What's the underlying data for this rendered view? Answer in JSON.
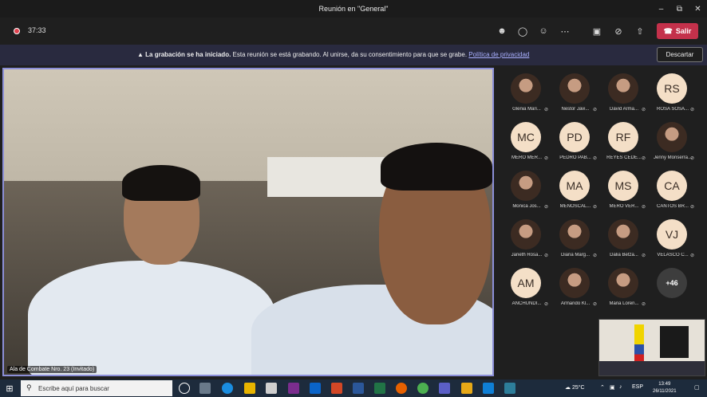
{
  "window": {
    "title": "Reunión en \"General\""
  },
  "toolbar": {
    "timer": "37:33",
    "leave_label": "Salir"
  },
  "banner": {
    "title": "La grabación se ha iniciado.",
    "message": "Esta reunión se está grabando. Al unirse, da su consentimiento para que se grabe.",
    "link": "Política de privacidad",
    "dismiss": "Descartar"
  },
  "stage": {
    "label": "Ala de Combate Nro. 23 (Invitado)"
  },
  "participants": [
    {
      "initials": "",
      "name": "Glenia Mari...",
      "photo": true
    },
    {
      "initials": "",
      "name": "Nestor Javi...",
      "photo": true
    },
    {
      "initials": "",
      "name": "David Arma...",
      "photo": true
    },
    {
      "initials": "RS",
      "name": "ROSA SOSA...",
      "photo": false
    },
    {
      "initials": "MC",
      "name": "MERO MER...",
      "photo": false
    },
    {
      "initials": "PD",
      "name": "PEDRO PAB...",
      "photo": false
    },
    {
      "initials": "RF",
      "name": "REYES CEDE...",
      "photo": false
    },
    {
      "initials": "",
      "name": "Jenny Monserra...",
      "photo": true
    },
    {
      "initials": "",
      "name": "Monica Jos...",
      "photo": true
    },
    {
      "initials": "MA",
      "name": "MENOSCAL...",
      "photo": false
    },
    {
      "initials": "MS",
      "name": "MERO VER...",
      "photo": false
    },
    {
      "initials": "CA",
      "name": "CANTOS BR...",
      "photo": false
    },
    {
      "initials": "",
      "name": "Janeth Rosa...",
      "photo": true
    },
    {
      "initials": "",
      "name": "Diana Marg...",
      "photo": true
    },
    {
      "initials": "",
      "name": "Dalia Betza...",
      "photo": true
    },
    {
      "initials": "VJ",
      "name": "VELASCO C...",
      "photo": false
    },
    {
      "initials": "AM",
      "name": "ANCHUNDI...",
      "photo": false
    },
    {
      "initials": "",
      "name": "Armando Kl...",
      "photo": true
    },
    {
      "initials": "",
      "name": "Maria Loren...",
      "photo": true
    },
    {
      "initials": "+46",
      "name": "",
      "photo": false,
      "more": true
    }
  ],
  "taskbar": {
    "search_placeholder": "Escribe aquí para buscar",
    "weather": "25°C",
    "lang": "ESP",
    "time": "13:49",
    "date": "26/11/2021"
  },
  "colors": {
    "accent": "#8c8fd8",
    "leave": "#c4314b",
    "banner": "#292a3f"
  }
}
